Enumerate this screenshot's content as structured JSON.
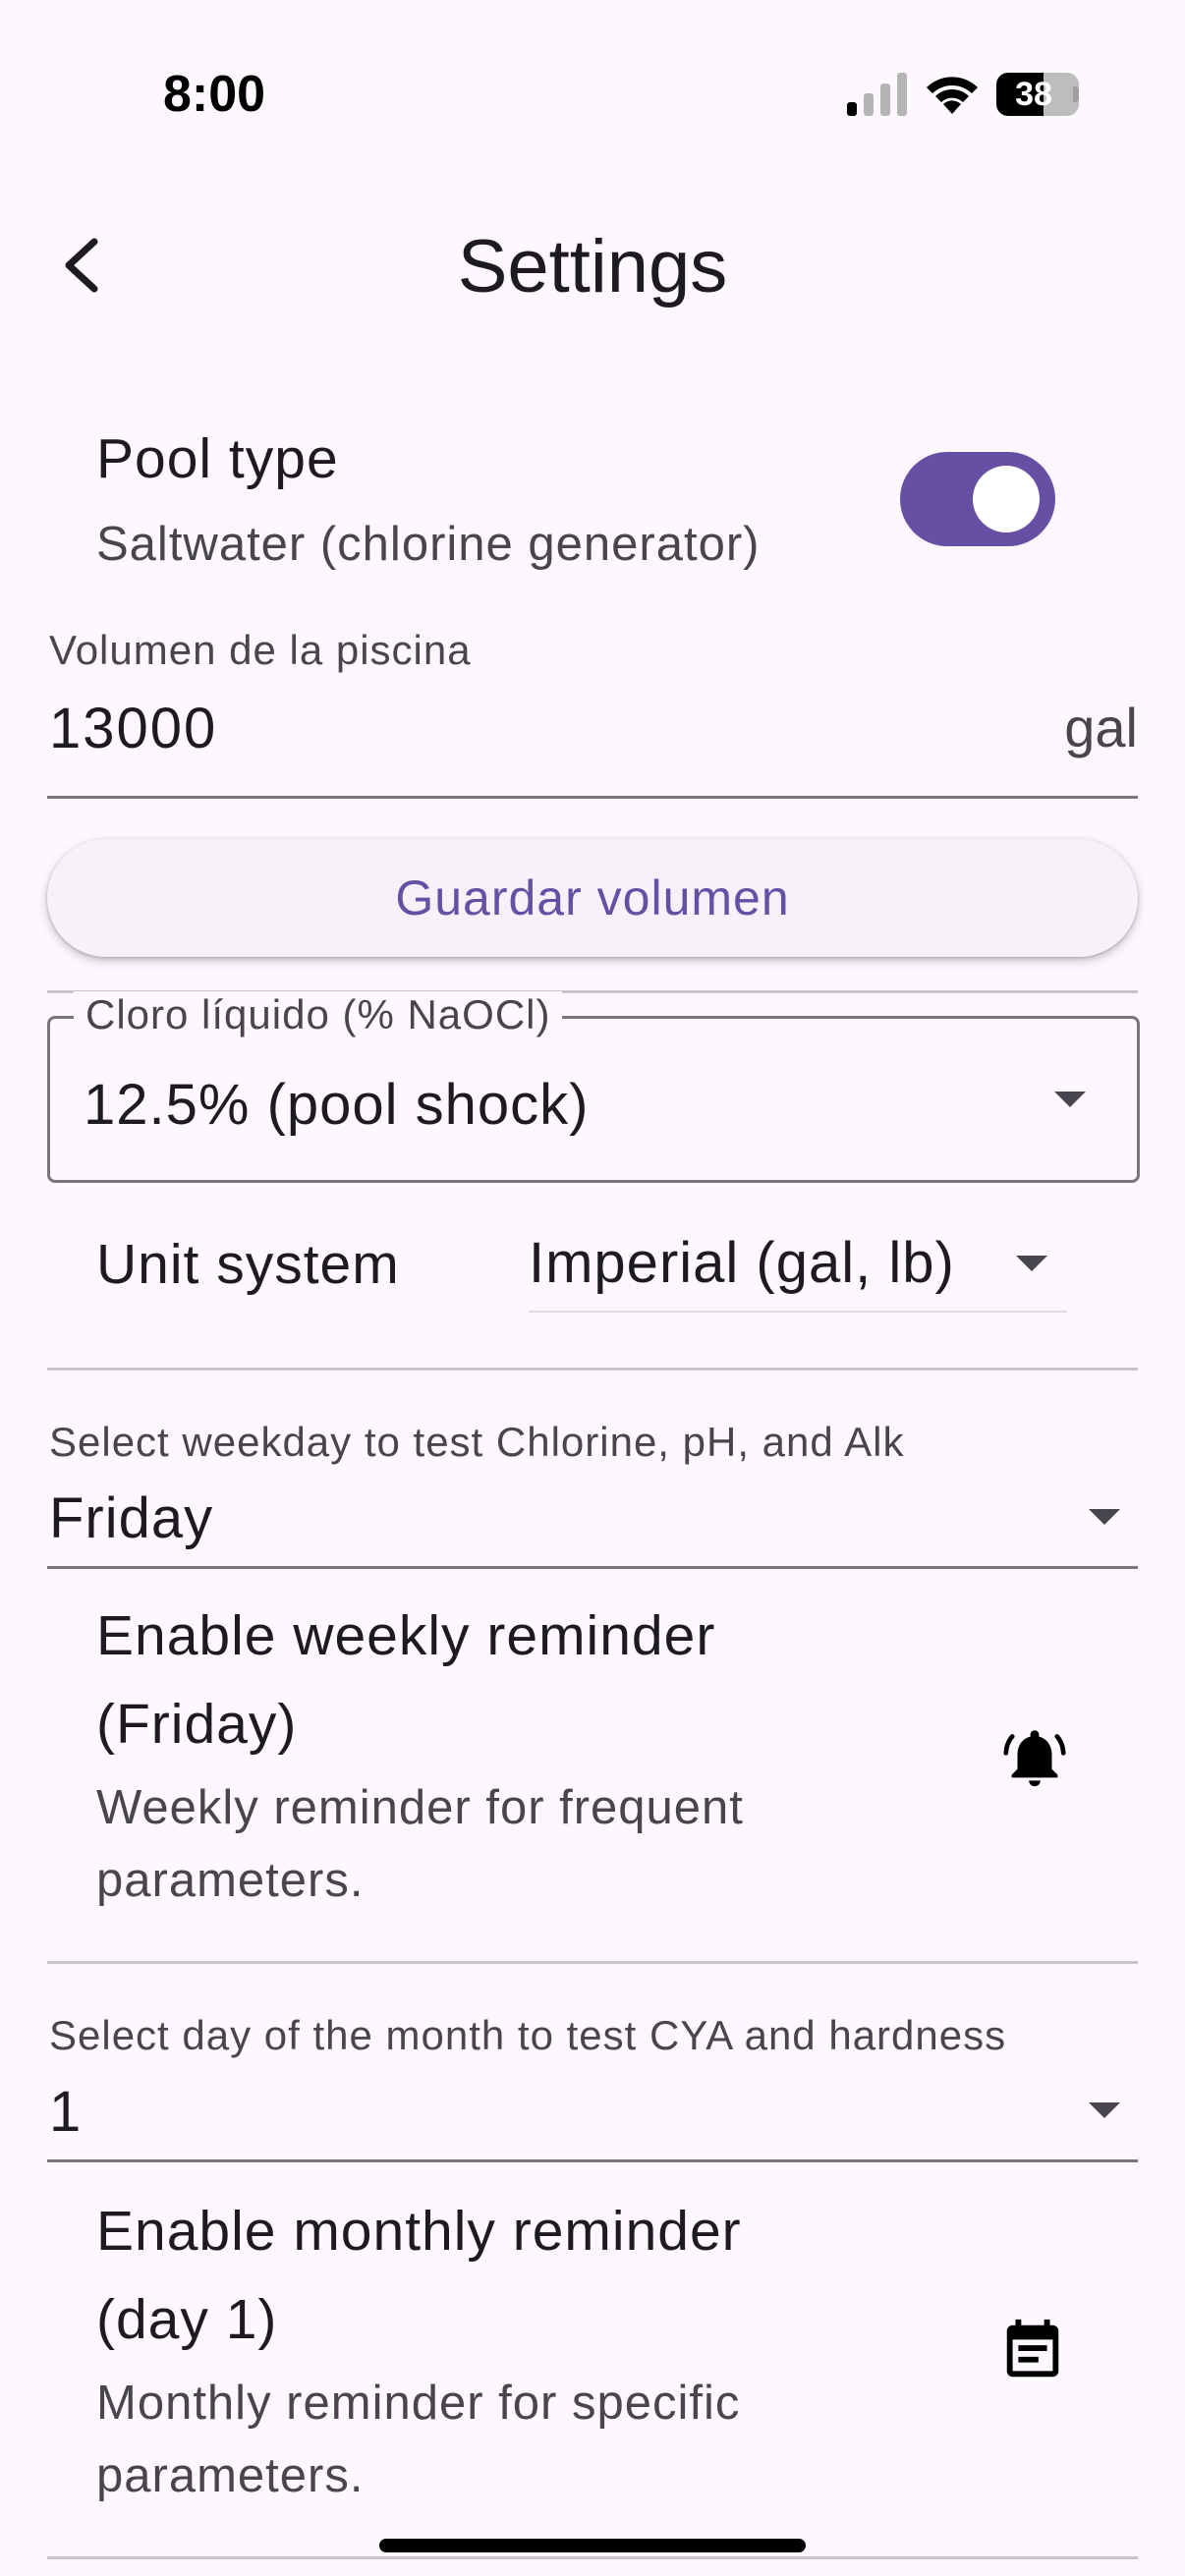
{
  "status_bar": {
    "time": "8:00",
    "battery": "38",
    "icons": [
      "cellular-signal-icon",
      "wifi-icon",
      "battery-icon"
    ]
  },
  "header": {
    "title": "Settings",
    "back_icon": "chevron-left-icon"
  },
  "pool_type": {
    "title": "Pool type",
    "subtitle": "Saltwater (chlorine generator)",
    "toggle_on": true,
    "accent": "#6750a4"
  },
  "volume": {
    "label": "Volumen de la piscina",
    "value": "13000",
    "unit": "gal",
    "save_label": "Guardar volumen"
  },
  "chlorine": {
    "label": "Cloro líquido (% NaOCl)",
    "value": "12.5% (pool shock)"
  },
  "units": {
    "label": "Unit system",
    "value": "Imperial (gal, lb)"
  },
  "weekly": {
    "select_label": "Select weekday to test Chlorine, pH, and Alk",
    "select_value": "Friday",
    "reminder_title_line1": "Enable weekly reminder",
    "reminder_title_line2": "(Friday)",
    "reminder_sub_line1": "Weekly reminder for frequent",
    "reminder_sub_line2": "parameters.",
    "icon": "bell-icon"
  },
  "monthly": {
    "select_label": "Select day of the month to test CYA and hardness",
    "select_value": "1",
    "reminder_title_line1": "Enable monthly reminder",
    "reminder_title_line2": "(day 1)",
    "reminder_sub_line1": "Monthly reminder for specific",
    "reminder_sub_line2": "parameters.",
    "icon": "calendar-icon"
  }
}
